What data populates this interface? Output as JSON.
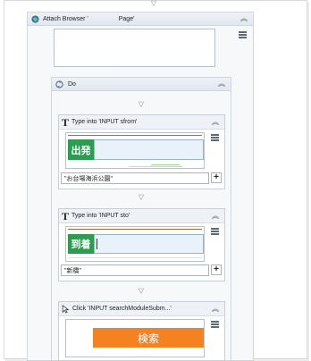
{
  "attach": {
    "title": "Attach Browser '",
    "title_suffix": "Page'"
  },
  "do_seq": {
    "title": "Do"
  },
  "type_from": {
    "title": "Type into 'INPUT  sfrom'",
    "label": "出発",
    "value": "\"お台場海浜公園\""
  },
  "type_to": {
    "title": "Type into 'INPUT  sto'",
    "label": "到着",
    "value": "\"新橋\""
  },
  "click": {
    "title": "Click 'INPUT  searchModuleSubm...'",
    "button": "検索"
  },
  "colors": {
    "green": "#2e9b52",
    "orange": "#f58220"
  }
}
